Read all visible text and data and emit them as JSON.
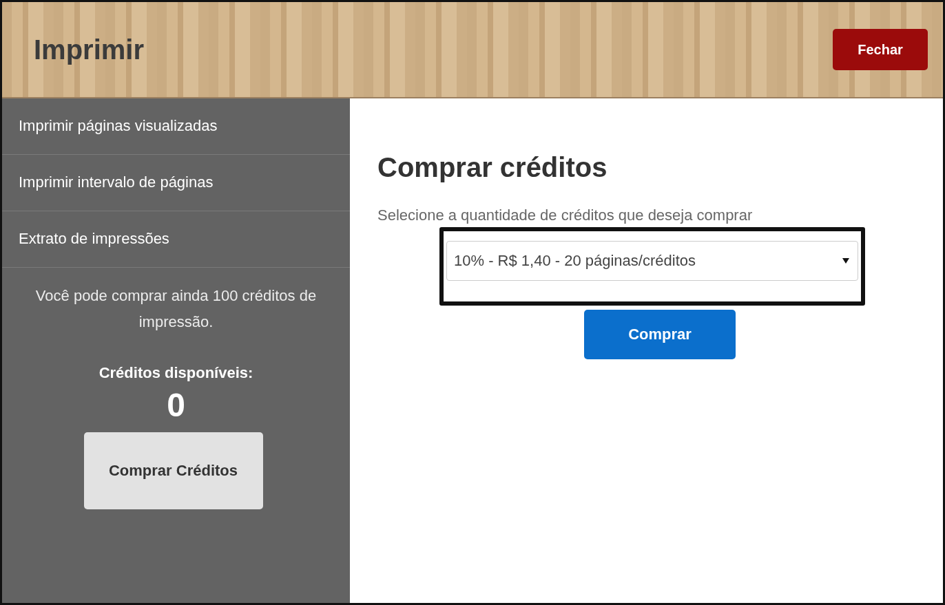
{
  "header": {
    "title": "Imprimir",
    "close_button": "Fechar"
  },
  "sidebar": {
    "items": [
      {
        "label": "Imprimir páginas visualizadas"
      },
      {
        "label": "Imprimir intervalo de páginas"
      },
      {
        "label": "Extrato de impressões"
      }
    ],
    "info": "Você pode comprar ainda 100 créditos de impressão.",
    "credits_label": "Créditos disponíveis:",
    "credits_value": "0",
    "buy_button": "Comprar Créditos"
  },
  "main": {
    "heading": "Comprar créditos",
    "instruction": "Selecione a quantidade de créditos que deseja comprar",
    "select_value": "10% - R$ 1,40 - 20 páginas/créditos",
    "buy_button": "Comprar"
  }
}
